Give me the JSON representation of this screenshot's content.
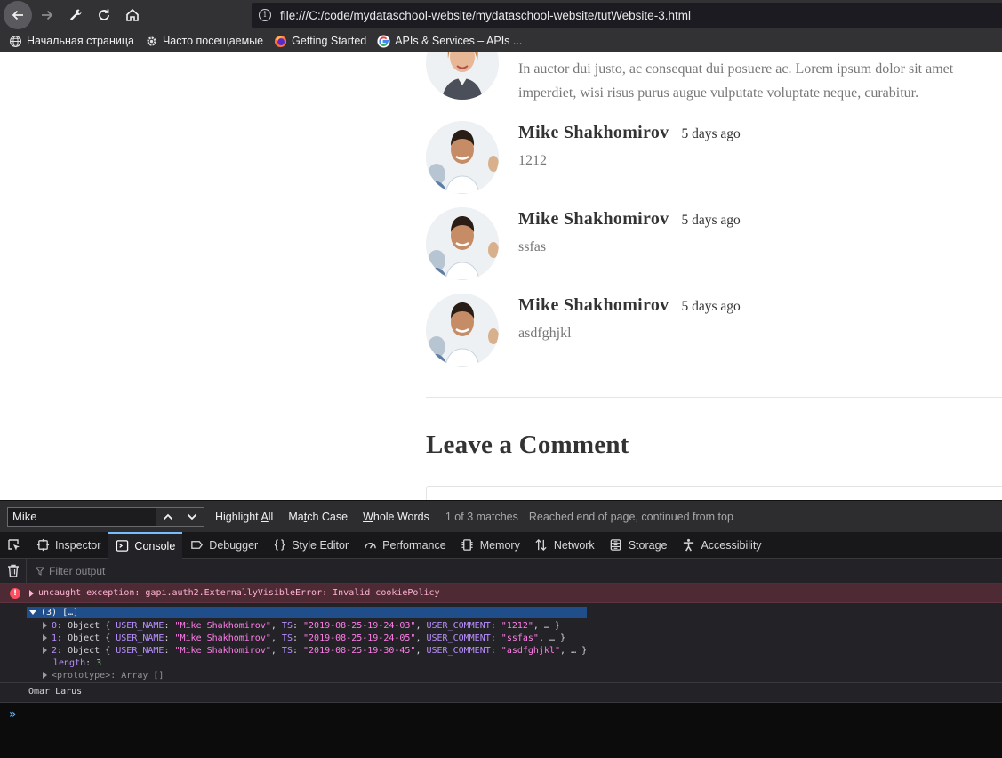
{
  "browser": {
    "url": "file:///C:/code/mydataschool-website/mydataschool-website/tutWebsite-3.html",
    "bookmarks": [
      {
        "label": "Начальная страница",
        "icon": "globe-icon"
      },
      {
        "label": "Часто посещаемые",
        "icon": "gear-icon"
      },
      {
        "label": "Getting Started",
        "icon": "firefox-icon"
      },
      {
        "label": "APIs & Services – APIs ...",
        "icon": "google-icon"
      }
    ]
  },
  "page": {
    "first_comment_lines": [
      "In auctor dui justo, ac consequat dui posuere ac. Lorem ipsum dolor sit amet",
      "imperdiet, wisi risus purus augue vulputate voluptate neque, curabitur."
    ],
    "comments": [
      {
        "author": "Mike Shakhomirov",
        "date": "5 days ago",
        "text": "1212"
      },
      {
        "author": "Mike Shakhomirov",
        "date": "5 days ago",
        "text": "ssfas"
      },
      {
        "author": "Mike Shakhomirov",
        "date": "5 days ago",
        "text": "asdfghjkl"
      }
    ],
    "leave_comment_title": "Leave a Comment"
  },
  "findbar": {
    "query": "Mike",
    "highlight_all_prefix": "Highlight ",
    "highlight_all_key": "A",
    "highlight_all_suffix": "ll",
    "match_case_prefix": "Ma",
    "match_case_key": "t",
    "match_case_suffix": "ch Case",
    "whole_words_key": "W",
    "whole_words_suffix": "hole Words",
    "match_count": "1 of 3 matches",
    "status": "Reached end of page, continued from top"
  },
  "devtools": {
    "tabs": [
      {
        "label": "Inspector",
        "icon": "inspector-icon"
      },
      {
        "label": "Console",
        "icon": "console-icon",
        "active": true
      },
      {
        "label": "Debugger",
        "icon": "debugger-icon"
      },
      {
        "label": "Style Editor",
        "icon": "style-editor-icon"
      },
      {
        "label": "Performance",
        "icon": "performance-icon"
      },
      {
        "label": "Memory",
        "icon": "memory-icon"
      },
      {
        "label": "Network",
        "icon": "network-icon"
      },
      {
        "label": "Storage",
        "icon": "storage-icon"
      },
      {
        "label": "Accessibility",
        "icon": "accessibility-icon"
      }
    ],
    "filter_placeholder": "Filter output",
    "error_message": "uncaught exception: gapi.auth2.ExternallyVisibleError: Invalid cookiePolicy",
    "array_header": "(3) […]",
    "entries": [
      {
        "index": "0",
        "user_name": "\"Mike Shakhomirov\"",
        "ts": "\"2019-08-25-19-24-03\"",
        "user_comment": "\"1212\""
      },
      {
        "index": "1",
        "user_name": "\"Mike Shakhomirov\"",
        "ts": "\"2019-08-25-19-24-05\"",
        "user_comment": "\"ssfas\""
      },
      {
        "index": "2",
        "user_name": "\"Mike Shakhomirov\"",
        "ts": "\"2019-08-25-19-30-45\"",
        "user_comment": "\"asdfghjkl\""
      }
    ],
    "length_label": "length",
    "length_value": "3",
    "prototype_label": "<prototype>",
    "prototype_value": "Array []",
    "log_output": "Omar Larus",
    "prompt": "»"
  },
  "colors": {
    "active_tab_accent": "#75bfff",
    "error_bg": "#4e2b34",
    "selection": "#204e8a"
  }
}
